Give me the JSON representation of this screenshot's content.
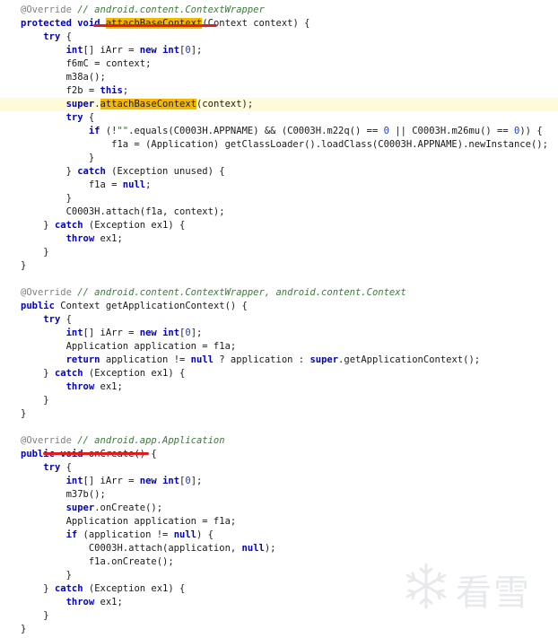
{
  "lines": [
    [
      [
        "ann",
        "@Override "
      ],
      [
        "com",
        "// android.content.ContextWrapper"
      ]
    ],
    [
      [
        "kw",
        "protected"
      ],
      [
        "pl",
        " "
      ],
      [
        "kw",
        "void"
      ],
      [
        "pl",
        " "
      ],
      [
        "mark",
        "attachBaseContext"
      ],
      [
        "pl",
        "(Context context) {"
      ]
    ],
    [
      [
        "pl",
        "    "
      ],
      [
        "kw",
        "try"
      ],
      [
        "pl",
        " {"
      ]
    ],
    [
      [
        "pl",
        "        "
      ],
      [
        "kw",
        "int"
      ],
      [
        "pl",
        "[] iArr = "
      ],
      [
        "kw",
        "new"
      ],
      [
        "pl",
        " "
      ],
      [
        "kw",
        "int"
      ],
      [
        "pl",
        "["
      ],
      [
        "num",
        "0"
      ],
      [
        "pl",
        "];"
      ]
    ],
    [
      [
        "pl",
        "        f6mC = context;"
      ]
    ],
    [
      [
        "pl",
        "        m38a();"
      ]
    ],
    [
      [
        "pl",
        "        f2b = "
      ],
      [
        "kw",
        "this"
      ],
      [
        "pl",
        ";"
      ]
    ],
    [
      [
        "pl",
        "        "
      ],
      [
        "kw",
        "super"
      ],
      [
        "pl",
        "."
      ],
      [
        "mark",
        "attachBaseContext"
      ],
      [
        "pl",
        "(context);"
      ]
    ],
    [
      [
        "pl",
        "        "
      ],
      [
        "kw",
        "try"
      ],
      [
        "pl",
        " {"
      ]
    ],
    [
      [
        "pl",
        "            "
      ],
      [
        "kw",
        "if"
      ],
      [
        "pl",
        " (!"
      ],
      [
        "str",
        "\"\""
      ],
      [
        "pl",
        ".equals(C0003H.APPNAME) && (C0003H.m22q() == "
      ],
      [
        "num",
        "0"
      ],
      [
        "pl",
        " || C0003H.m26mu() == "
      ],
      [
        "num",
        "0"
      ],
      [
        "pl",
        ")) {"
      ]
    ],
    [
      [
        "pl",
        "                f1a = (Application) getClassLoader().loadClass(C0003H.APPNAME).newInstance();"
      ]
    ],
    [
      [
        "pl",
        "            }"
      ]
    ],
    [
      [
        "pl",
        "        } "
      ],
      [
        "kw",
        "catch"
      ],
      [
        "pl",
        " (Exception unused) {"
      ]
    ],
    [
      [
        "pl",
        "            f1a = "
      ],
      [
        "kw",
        "null"
      ],
      [
        "pl",
        ";"
      ]
    ],
    [
      [
        "pl",
        "        }"
      ]
    ],
    [
      [
        "pl",
        "        C0003H.attach(f1a, context);"
      ]
    ],
    [
      [
        "pl",
        "    } "
      ],
      [
        "kw",
        "catch"
      ],
      [
        "pl",
        " (Exception ex1) {"
      ]
    ],
    [
      [
        "pl",
        "        "
      ],
      [
        "kw",
        "throw"
      ],
      [
        "pl",
        " ex1;"
      ]
    ],
    [
      [
        "pl",
        "    }"
      ]
    ],
    [
      [
        "pl",
        "}"
      ]
    ],
    [],
    [
      [
        "ann",
        "@Override "
      ],
      [
        "com",
        "// android.content.ContextWrapper, android.content.Context"
      ]
    ],
    [
      [
        "kw",
        "public"
      ],
      [
        "pl",
        " Context getApplicationContext() {"
      ]
    ],
    [
      [
        "pl",
        "    "
      ],
      [
        "kw",
        "try"
      ],
      [
        "pl",
        " {"
      ]
    ],
    [
      [
        "pl",
        "        "
      ],
      [
        "kw",
        "int"
      ],
      [
        "pl",
        "[] iArr = "
      ],
      [
        "kw",
        "new"
      ],
      [
        "pl",
        " "
      ],
      [
        "kw",
        "int"
      ],
      [
        "pl",
        "["
      ],
      [
        "num",
        "0"
      ],
      [
        "pl",
        "];"
      ]
    ],
    [
      [
        "pl",
        "        Application application = f1a;"
      ]
    ],
    [
      [
        "pl",
        "        "
      ],
      [
        "kw",
        "return"
      ],
      [
        "pl",
        " application != "
      ],
      [
        "kw",
        "null"
      ],
      [
        "pl",
        " ? application : "
      ],
      [
        "kw",
        "super"
      ],
      [
        "pl",
        ".getApplicationContext();"
      ]
    ],
    [
      [
        "pl",
        "    } "
      ],
      [
        "kw",
        "catch"
      ],
      [
        "pl",
        " (Exception ex1) {"
      ]
    ],
    [
      [
        "pl",
        "        "
      ],
      [
        "kw",
        "throw"
      ],
      [
        "pl",
        " ex1;"
      ]
    ],
    [
      [
        "pl",
        "    }"
      ]
    ],
    [
      [
        "pl",
        "}"
      ]
    ],
    [],
    [
      [
        "ann",
        "@Override "
      ],
      [
        "com",
        "// android.app.Application"
      ]
    ],
    [
      [
        "kw",
        "public"
      ],
      [
        "pl",
        " "
      ],
      [
        "kw",
        "void"
      ],
      [
        "pl",
        " onCreate() {"
      ]
    ],
    [
      [
        "pl",
        "    "
      ],
      [
        "kw",
        "try"
      ],
      [
        "pl",
        " {"
      ]
    ],
    [
      [
        "pl",
        "        "
      ],
      [
        "kw",
        "int"
      ],
      [
        "pl",
        "[] iArr = "
      ],
      [
        "kw",
        "new"
      ],
      [
        "pl",
        " "
      ],
      [
        "kw",
        "int"
      ],
      [
        "pl",
        "["
      ],
      [
        "num",
        "0"
      ],
      [
        "pl",
        "];"
      ]
    ],
    [
      [
        "pl",
        "        m37b();"
      ]
    ],
    [
      [
        "pl",
        "        "
      ],
      [
        "kw",
        "super"
      ],
      [
        "pl",
        ".onCreate();"
      ]
    ],
    [
      [
        "pl",
        "        Application application = f1a;"
      ]
    ],
    [
      [
        "pl",
        "        "
      ],
      [
        "kw",
        "if"
      ],
      [
        "pl",
        " (application != "
      ],
      [
        "kw",
        "null"
      ],
      [
        "pl",
        ") {"
      ]
    ],
    [
      [
        "pl",
        "            C0003H.attach(application, "
      ],
      [
        "kw",
        "null"
      ],
      [
        "pl",
        ");"
      ]
    ],
    [
      [
        "pl",
        "            f1a.onCreate();"
      ]
    ],
    [
      [
        "pl",
        "        }"
      ]
    ],
    [
      [
        "pl",
        "    } "
      ],
      [
        "kw",
        "catch"
      ],
      [
        "pl",
        " (Exception ex1) {"
      ]
    ],
    [
      [
        "pl",
        "        "
      ],
      [
        "kw",
        "throw"
      ],
      [
        "pl",
        " ex1;"
      ]
    ],
    [
      [
        "pl",
        "    }"
      ]
    ],
    [
      [
        "pl",
        "}"
      ]
    ]
  ],
  "highlighted_line_index": 7,
  "watermark": {
    "icon": "snowflake-icon",
    "text": "看雪"
  },
  "colors": {
    "keyword": "#0000c8",
    "annotation": "#808080",
    "comment": "#3c7a3c",
    "highlight_mark": "#f5b800",
    "line_highlight": "#fdfbd8",
    "underline": "#e11d1d"
  }
}
